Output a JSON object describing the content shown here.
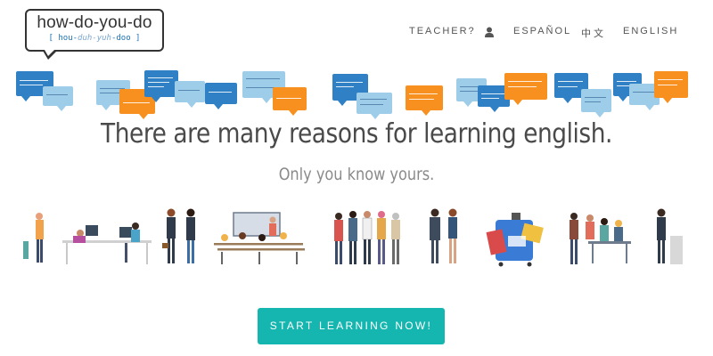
{
  "logo": {
    "title": "how-do-you-do",
    "sub_prefix": "[ hou-",
    "sub_italic": "duh-yuh",
    "sub_suffix": "-doo ]"
  },
  "nav": {
    "teacher": "TEACHER?",
    "user_icon": "user-icon",
    "espanol": "ESPAÑOL",
    "chinese": "中文",
    "english": "ENGLISH"
  },
  "colors": {
    "accent": "#16b6b0",
    "bubble_blue": "#2f80c4",
    "bubble_light": "#9ecde9",
    "bubble_orange": "#f7901e"
  },
  "headline": "There are many reasons for learning english.",
  "subline": "Only you know yours.",
  "cta": {
    "label": "START LEARNING NOW!"
  },
  "illustrations": [
    "office-workers",
    "business-couple",
    "classroom",
    "group-of-friends",
    "business-pair",
    "travel-suitcase",
    "presentation-audience"
  ]
}
